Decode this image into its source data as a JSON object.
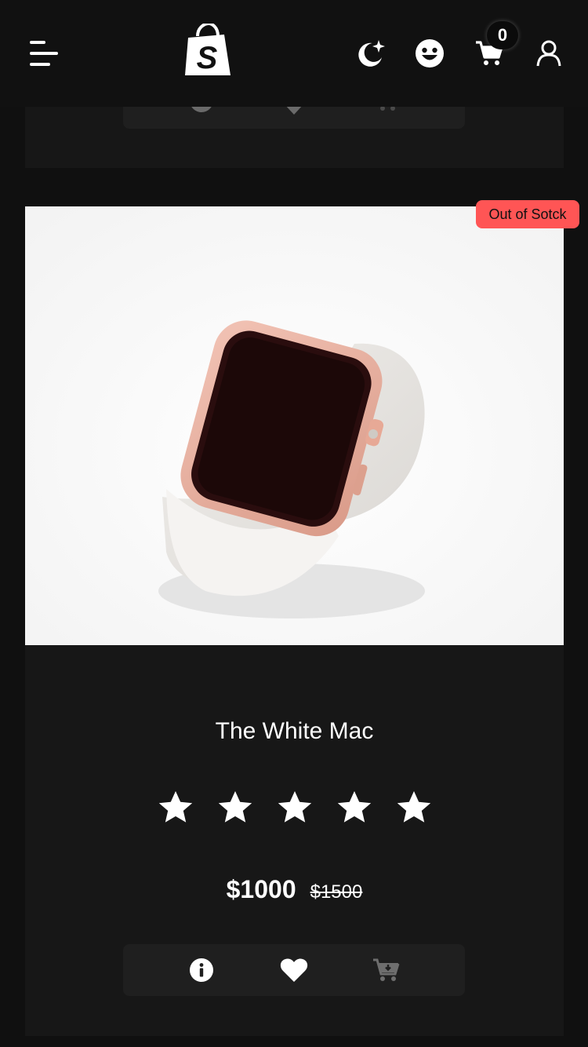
{
  "header": {
    "cart_count": "0",
    "icons": [
      "menu-icon",
      "shopify-logo",
      "moon-icon",
      "smiley-icon",
      "cart-icon",
      "user-icon"
    ]
  },
  "product": {
    "badge": "Out of Sotck",
    "title": "The White Mac",
    "rating": 5,
    "rating_max": 5,
    "price": "$1000",
    "old_price": "$1500",
    "image": "pink smartwatch with white band"
  },
  "actions": {
    "icons": [
      "info-icon",
      "heart-icon",
      "add-to-cart-icon"
    ]
  },
  "colors": {
    "background": "#101010",
    "card": "#171717",
    "action_bar": "#1f1f1f",
    "badge": "#ff5555",
    "text": "#ffffff",
    "disabled_icon": "#6e6e6e"
  }
}
